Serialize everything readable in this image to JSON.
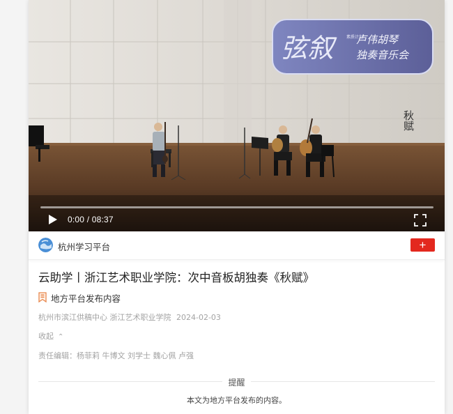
{
  "video": {
    "banner_main": "弦叙",
    "banner_small": "素质计划",
    "banner_line1": "卢伟胡琴",
    "banner_line2": "独奏音乐会",
    "side_caption": "秋赋",
    "time_display": "0:00 / 08:37",
    "progress_fraction": 0.0,
    "play_icon": "play-icon",
    "fullscreen_icon": "fullscreen-icon"
  },
  "author": {
    "name": "杭州学习平台",
    "follow_label": "+"
  },
  "article": {
    "title": "云助学丨浙江艺术职业学院：次中音板胡独奏《秋赋》",
    "source_label": "地方平台发布内容",
    "meta_org": "杭州市滨江供稿中心 浙江艺术职业学院",
    "meta_date": "2024-02-03",
    "collapse_label": "收起",
    "editors": "责任编辑：杨菲莉 牛博文 刘学士 魏心佩 卢强"
  },
  "notice": {
    "title": "提醒",
    "body": "本文为地方平台发布的内容。"
  },
  "colors": {
    "accent_red": "#e3281e",
    "meta_gray": "#a3a3a3",
    "banner_purple": "#6b6fa8"
  }
}
